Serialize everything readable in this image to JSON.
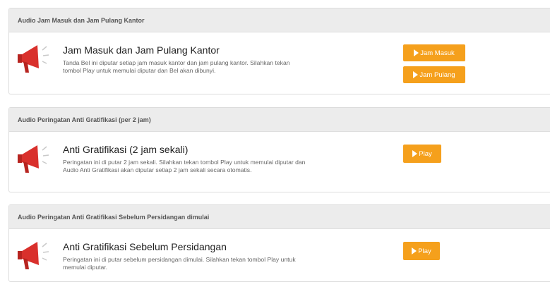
{
  "sections": [
    {
      "header": "Audio Jam Masuk dan Jam Pulang Kantor",
      "title": "Jam Masuk dan Jam Pulang Kantor",
      "description": "Tanda Bel ini diputar setiap jam masuk kantor dan jam pulang kantor. Silahkan tekan tombol Play untuk memulai diputar dan Bel akan dibunyi.",
      "buttons": [
        "Jam Masuk",
        "Jam Pulang"
      ]
    },
    {
      "header": "Audio Peringatan Anti Gratifikasi (per 2 jam)",
      "title": "Anti Gratifikasi (2 jam sekali)",
      "description": "Peringatan ini di putar 2 jam sekali. Silahkan tekan tombol Play untuk memulai diputar dan Audio Anti Gratifikasi akan diputar setiap 2 jam sekali secara otomatis.",
      "buttons": [
        "Play"
      ]
    },
    {
      "header": "Audio Peringatan Anti Gratifikasi Sebelum Persidangan dimulai",
      "title": "Anti Gratifikasi Sebelum Persidangan",
      "description": "Peringatan ini di putar sebelum persidangan dimulai. Silahkan tekan tombol Play untuk memulai diputar.",
      "buttons": [
        "Play"
      ]
    }
  ],
  "icon": "megaphone-icon",
  "colors": {
    "accent": "#f5a01c",
    "megaphone": "#d9302c",
    "header_bg": "#ececec"
  }
}
